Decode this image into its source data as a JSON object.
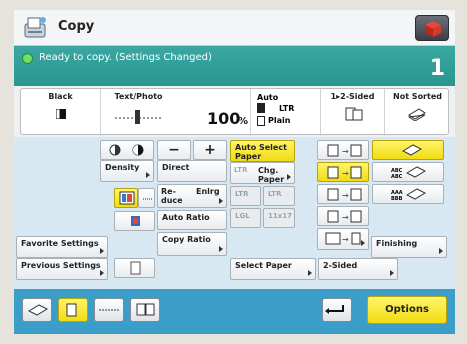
{
  "app": {
    "title": "Copy"
  },
  "status": {
    "message": "Ready to copy. (Settings Changed)",
    "copies": "1"
  },
  "summary": {
    "color": "Black",
    "text_photo": "Text/Photo",
    "zoom": "100",
    "zoom_unit": "%",
    "paper_label": "Auto",
    "paper_size": "LTR",
    "paper_type": "Plain",
    "sided": "1▸2-Sided",
    "sort": "Not Sorted"
  },
  "main": {
    "density_label": "Density",
    "direct_label": "Direct",
    "auto_select_paper": "Auto Select Paper",
    "paper_ltr": "LTR",
    "chg_paper": "Chg. Paper",
    "reduce": "Re-duce",
    "enlarge": "Enlrg",
    "auto_ratio": "Auto Ratio",
    "ltr2": "LTR",
    "ltr3": "LTR",
    "lgl": "LGL",
    "p11x17": "11x17",
    "favorite": "Favorite Settings",
    "copy_ratio": "Copy Ratio",
    "finishing": "Finishing",
    "previous": "Previous Settings",
    "select_paper": "Select Paper",
    "two_sided": "2-Sided",
    "minus": "−",
    "plus": "+"
  },
  "bottom": {
    "options": "Options"
  }
}
